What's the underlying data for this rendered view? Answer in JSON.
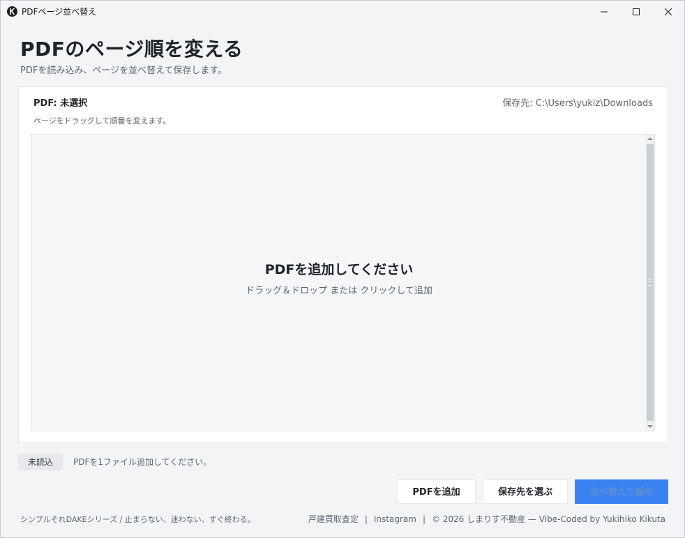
{
  "window": {
    "title": "PDFページ並べ替え",
    "icons": {
      "app": "app-logo-icon",
      "minimize": "minimize-icon",
      "maximize": "maximize-icon",
      "close": "close-icon"
    }
  },
  "header": {
    "title": "PDFのページ順を変える",
    "subtitle": "PDFを読み込み、ページを並べ替えて保存します。"
  },
  "panel": {
    "pdf_label": "PDF: 未選択",
    "save_path": "保存先: C:\\Users\\yukiz\\Downloads",
    "hint": "ページをドラッグして順番を変えます。",
    "dropzone": {
      "title": "PDFを追加してください",
      "subtitle": "ドラッグ＆ドロップ または クリックして追加"
    }
  },
  "status": {
    "badge": "未読込",
    "message": "PDFを1ファイル追加してください。"
  },
  "buttons": {
    "add_pdf": "PDFを追加",
    "choose_save": "保存先を選ぶ",
    "reorder_save": "並べ替えて保存"
  },
  "footer": {
    "tagline": "シンプルそれDAKEシリーズ / 止まらない、迷わない、すぐ終わる。",
    "link1": "戸建買取査定",
    "divider": "|",
    "link2": "Instagram",
    "credit": "© 2026 しまりす不動産 — Vibe-Coded by Yukihiko Kikuta"
  },
  "colors": {
    "accent": "#3a82f0",
    "background": "#f3f4f6",
    "panel": "#ffffff",
    "dropzone": "#f5f6f8"
  }
}
